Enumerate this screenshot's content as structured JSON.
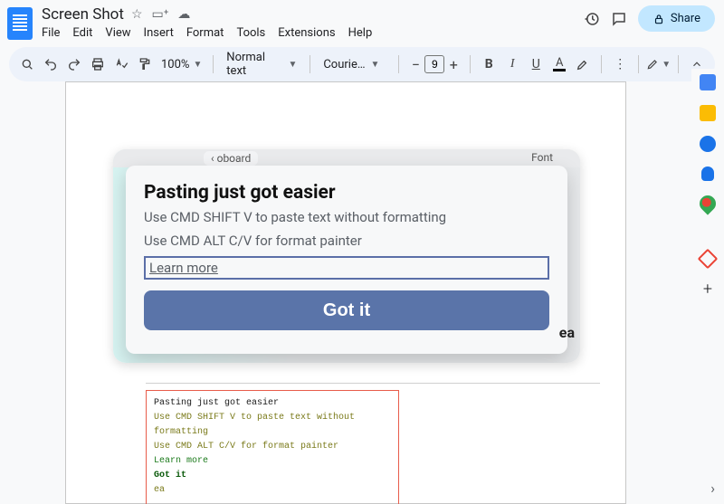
{
  "header": {
    "doc_title": "Screen Shot",
    "star_tooltip": "Star",
    "move_tooltip": "Move",
    "cloud_tooltip": "See document status",
    "share_label": "Share"
  },
  "menu": {
    "items": [
      "File",
      "Edit",
      "View",
      "Insert",
      "Format",
      "Tools",
      "Extensions",
      "Help"
    ]
  },
  "toolbar": {
    "zoom": "100%",
    "style": "Normal text",
    "font": "Courie…",
    "font_size": "9"
  },
  "sidepanel": {
    "items": [
      "calendar",
      "keep",
      "tasks",
      "contacts",
      "maps",
      "drops",
      "add"
    ]
  },
  "doc": {
    "inner_frag1": "oboard",
    "inner_frag2": "Font",
    "dialog": {
      "title": "Pasting just got easier",
      "line1": "Use CMD SHIFT V to paste text without formatting",
      "line2": "Use CMD ALT C/V for format painter",
      "learn": "Learn more",
      "gotit": "Got it"
    },
    "ea": "ea",
    "ocr": {
      "l1": "Pasting just got easier",
      "l2": "Use CMD SHIFT V to paste text without formatting",
      "l3": "Use CMD ALT C/V for format painter",
      "l4": "Learn more",
      "l5": "Got it",
      "l6": "ea"
    }
  }
}
